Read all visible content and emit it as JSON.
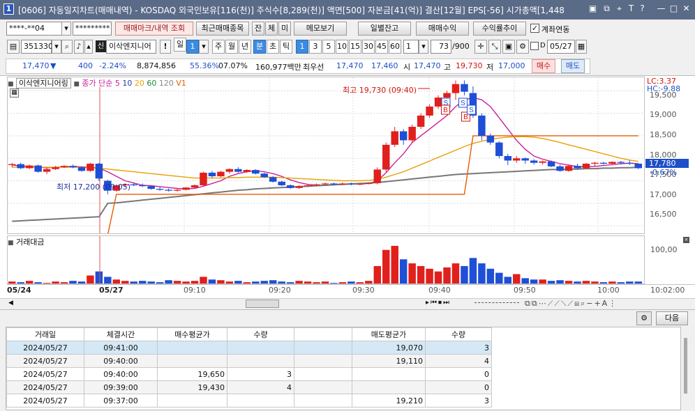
{
  "window": {
    "number": "1",
    "title": "[0606] 자동일지차트(매매내역) - KOSDAQ 외국인보유[116(천)] 주식수[8,289(천)] 액면[500] 자본금[41(억)] 결산[12월] EPS[-56] 시가총액[1,448"
  },
  "toolbar1": {
    "account": "****-**04",
    "password": "*********",
    "tabs": [
      "매매마크/내역 조회",
      "최근매매종목",
      "잔",
      "체",
      "미",
      "메모보기"
    ],
    "buttons": [
      "일별잔고",
      "매매수익",
      "수익률추이"
    ],
    "link_label": "계좌연동",
    "link_checked": true
  },
  "toolbar2": {
    "code": "351330",
    "badge": "신",
    "name": "이삭엔지니어",
    "period": [
      "일",
      "1",
      "주",
      "월",
      "년",
      "분",
      "초",
      "틱"
    ],
    "intervals": [
      "1",
      "3",
      "5",
      "10",
      "15",
      "30",
      "45",
      "60"
    ],
    "interval_select": "1",
    "count": "73",
    "count_total": "/900",
    "date": "05/27"
  },
  "quote": {
    "price": "17,470",
    "dir": "▼",
    "change": "400",
    "change_pct": "-2.24%",
    "volume": "8,874,856",
    "ratio": "55.36%",
    "ratio2": "07.07%",
    "amount": "160,977백만",
    "best_label": "최우선",
    "best_ask": "17,470",
    "best_bid": "17,460",
    "open_label": "시",
    "open": "17,470",
    "high_label": "고",
    "high": "19,730",
    "low_label": "저",
    "low": "17,000",
    "buy_label": "매수",
    "sell_label": "매도"
  },
  "chart": {
    "legend": {
      "name": "이삭엔지니어링",
      "ma_label": "종가 단순",
      "ma": [
        "5",
        "10",
        "20",
        "60",
        "120"
      ],
      "v": "V1"
    },
    "lc": "LC:3.37",
    "hc": "HC:-9.88",
    "annotations": {
      "max": "최고 19,730 (09:40)",
      "min": "최저 17,200 (09:05)"
    },
    "last": "17,780",
    "last_pct": "-0.67%",
    "y_labels": [
      "19,500",
      "19,000",
      "18,500",
      "18,000",
      "17,500",
      "17,000",
      "16,500"
    ],
    "markers": [
      "S",
      "B",
      "B",
      "S",
      "S"
    ],
    "vol_title": "거래대금",
    "vol_y": "100,00",
    "x_labels": [
      "05/24",
      "05/27",
      "09:10",
      "09:20",
      "09:30",
      "09:40",
      "09:50",
      "10:00",
      "10:02:00"
    ]
  },
  "chart_data": {
    "type": "candlestick",
    "y_range": [
      16300,
      19800
    ],
    "candles": [
      [
        17850,
        17900,
        17800,
        17870
      ],
      [
        17870,
        17900,
        17760,
        17780
      ],
      [
        17780,
        17860,
        17760,
        17840
      ],
      [
        17840,
        17860,
        17680,
        17700
      ],
      [
        17700,
        17780,
        17650,
        17760
      ],
      [
        17760,
        17830,
        17740,
        17800
      ],
      [
        17800,
        17850,
        17780,
        17830
      ],
      [
        17830,
        17860,
        17780,
        17800
      ],
      [
        17800,
        17820,
        17700,
        17720
      ],
      [
        17720,
        17900,
        17700,
        17880
      ],
      [
        17880,
        17900,
        17500,
        17550
      ],
      [
        17500,
        17520,
        17200,
        17280
      ],
      [
        17280,
        17420,
        17260,
        17400
      ],
      [
        17400,
        17440,
        17360,
        17420
      ],
      [
        17420,
        17460,
        17380,
        17400
      ],
      [
        17400,
        17440,
        17360,
        17380
      ],
      [
        17380,
        17400,
        17300,
        17320
      ],
      [
        17320,
        17360,
        17280,
        17300
      ],
      [
        17300,
        17330,
        17260,
        17280
      ],
      [
        17280,
        17320,
        17260,
        17300
      ],
      [
        17300,
        17360,
        17290,
        17350
      ],
      [
        17350,
        17420,
        17330,
        17400
      ],
      [
        17400,
        17700,
        17380,
        17680
      ],
      [
        17680,
        17720,
        17560,
        17600
      ],
      [
        17600,
        17720,
        17580,
        17700
      ],
      [
        17700,
        17780,
        17660,
        17760
      ],
      [
        17760,
        17800,
        17680,
        17700
      ],
      [
        17700,
        17760,
        17680,
        17740
      ],
      [
        17740,
        17760,
        17640,
        17660
      ],
      [
        17660,
        17680,
        17560,
        17580
      ],
      [
        17580,
        17600,
        17460,
        17480
      ],
      [
        17480,
        17500,
        17380,
        17400
      ],
      [
        17400,
        17420,
        17320,
        17340
      ],
      [
        17340,
        17400,
        17320,
        17380
      ],
      [
        17380,
        17420,
        17360,
        17400
      ],
      [
        17400,
        17440,
        17380,
        17420
      ],
      [
        17420,
        17460,
        17400,
        17440
      ],
      [
        17440,
        17460,
        17400,
        17420
      ],
      [
        17420,
        17460,
        17410,
        17440
      ],
      [
        17440,
        17460,
        17400,
        17420
      ],
      [
        17420,
        17440,
        17400,
        17430
      ],
      [
        17430,
        17460,
        17420,
        17450
      ],
      [
        17450,
        17800,
        17420,
        17750
      ],
      [
        17750,
        18350,
        17700,
        18300
      ],
      [
        18300,
        18700,
        18250,
        18600
      ],
      [
        18600,
        18650,
        18300,
        18400
      ],
      [
        18400,
        18750,
        18350,
        18700
      ],
      [
        18700,
        19000,
        18650,
        18950
      ],
      [
        18950,
        19200,
        18900,
        19150
      ],
      [
        19150,
        19400,
        19100,
        19350
      ],
      [
        19350,
        19500,
        19300,
        19450
      ],
      [
        19450,
        19730,
        19300,
        19650
      ],
      [
        19650,
        19730,
        19400,
        19480
      ],
      [
        19450,
        19600,
        18900,
        18950
      ],
      [
        18950,
        19000,
        18400,
        18500
      ],
      [
        18500,
        18550,
        18300,
        18350
      ],
      [
        18350,
        18380,
        18000,
        18050
      ],
      [
        18050,
        18100,
        17850,
        17950
      ],
      [
        17950,
        18050,
        17900,
        18000
      ],
      [
        18000,
        18020,
        17880,
        17950
      ],
      [
        17950,
        17980,
        17860,
        17900
      ],
      [
        17900,
        17950,
        17860,
        17930
      ],
      [
        17930,
        17950,
        17800,
        17820
      ],
      [
        17820,
        17860,
        17700,
        17720
      ],
      [
        17720,
        17860,
        17700,
        17830
      ],
      [
        17830,
        17880,
        17750,
        17780
      ],
      [
        17780,
        17900,
        17760,
        17880
      ],
      [
        17880,
        17920,
        17820,
        17900
      ],
      [
        17900,
        17920,
        17860,
        17880
      ],
      [
        17880,
        17930,
        17860,
        17920
      ],
      [
        17920,
        17940,
        17860,
        17900
      ],
      [
        17900,
        17950,
        17850,
        17880
      ],
      [
        17880,
        17890,
        17760,
        17780
      ]
    ],
    "volume": [
      5,
      4,
      6,
      4,
      3,
      5,
      4,
      6,
      5,
      14,
      20,
      12,
      8,
      6,
      5,
      6,
      5,
      4,
      7,
      6,
      5,
      6,
      12,
      8,
      7,
      5,
      6,
      4,
      5,
      6,
      7,
      5,
      4,
      6,
      5,
      4,
      5,
      3,
      4,
      5,
      4,
      6,
      28,
      52,
      58,
      38,
      32,
      28,
      24,
      20,
      26,
      32,
      28,
      40,
      32,
      24,
      18,
      12,
      16,
      10,
      8,
      8,
      6,
      7,
      6,
      5,
      6,
      5,
      4,
      5,
      4,
      5,
      5
    ],
    "ma": {
      "5": [
        17850,
        17830,
        17820,
        17800,
        17790,
        17800,
        17810,
        17820,
        17810,
        17800,
        17780,
        17700,
        17600,
        17500,
        17450,
        17400,
        17390,
        17370,
        17350,
        17330,
        17320,
        17330,
        17380,
        17440,
        17500,
        17600,
        17660,
        17700,
        17720,
        17700,
        17660,
        17600,
        17520,
        17460,
        17420,
        17400,
        17400,
        17410,
        17420,
        17430,
        17430,
        17440,
        17500,
        17680,
        17900,
        18100,
        18350,
        18500,
        18650,
        18800,
        18950,
        19150,
        19300,
        19350,
        19300,
        19150,
        18900,
        18650,
        18400,
        18200,
        18050,
        17980,
        17930,
        17880,
        17850,
        17820,
        17810,
        17820,
        17840,
        17860,
        17880,
        17890,
        17880
      ],
      "20": [
        17800,
        17800,
        17800,
        17800,
        17800,
        17800,
        17800,
        17800,
        17800,
        17790,
        17780,
        17760,
        17740,
        17720,
        17700,
        17680,
        17660,
        17640,
        17620,
        17600,
        17580,
        17560,
        17560,
        17560,
        17560,
        17570,
        17570,
        17580,
        17580,
        17580,
        17580,
        17570,
        17560,
        17550,
        17540,
        17530,
        17520,
        17510,
        17500,
        17500,
        17500,
        17510,
        17530,
        17580,
        17640,
        17700,
        17780,
        17860,
        17940,
        18020,
        18100,
        18180,
        18260,
        18330,
        18380,
        18420,
        18450,
        18470,
        18480,
        18480,
        18470,
        18440,
        18400,
        18350,
        18300,
        18250,
        18200,
        18150,
        18100,
        18050,
        18000,
        17960,
        17930
      ],
      "120": [
        16600,
        16610,
        16620,
        16630,
        16640,
        16650,
        16660,
        16670,
        16680,
        16690,
        16700,
        17000,
        17010,
        17030,
        17050,
        17070,
        17090,
        17110,
        17130,
        17150,
        17170,
        17190,
        17210,
        17230,
        17250,
        17270,
        17290,
        17300,
        17320,
        17330,
        17340,
        17350,
        17360,
        17370,
        17380,
        17390,
        17400,
        17410,
        17420,
        17430,
        17440,
        17450,
        17460,
        17480,
        17500,
        17520,
        17540,
        17560,
        17580,
        17600,
        17620,
        17640,
        17650,
        17660,
        17670,
        17680,
        17690,
        17700,
        17710,
        17720,
        17730,
        17740,
        17750,
        17750,
        17760,
        17760,
        17770,
        17770,
        17780,
        17780,
        17790,
        17790,
        17800
      ],
      "v": [
        16300,
        16300,
        16300,
        16300,
        16300,
        16300,
        16300,
        16300,
        16300,
        16300,
        16300,
        16300,
        17200,
        17200,
        17200,
        17200,
        17200,
        17200,
        17200,
        17200,
        17200,
        17200,
        17200,
        17200,
        17200,
        17200,
        17200,
        17200,
        17200,
        17200,
        17200,
        17200,
        17200,
        17200,
        17200,
        17200,
        17200,
        17200,
        17200,
        17200,
        17200,
        17200,
        17200,
        17200,
        17200,
        17200,
        17200,
        17200,
        17200,
        17200,
        17200,
        17200,
        17200,
        18500,
        18500,
        18500,
        18500,
        18500,
        18500,
        18500,
        18500,
        18500,
        18500,
        18500,
        18500,
        18500,
        18500,
        18500,
        18500,
        18500,
        18500,
        18500,
        18500
      ]
    }
  },
  "trades": {
    "headers": [
      "거래일",
      "체결시간",
      "매수평균가",
      "수량",
      "",
      "매도평균가",
      "수량"
    ],
    "rows": [
      [
        "2024/05/27",
        "09:41:00",
        "",
        "",
        "",
        "19,070",
        "3"
      ],
      [
        "2024/05/27",
        "09:40:00",
        "",
        "",
        "",
        "19,110",
        "4"
      ],
      [
        "2024/05/27",
        "09:40:00",
        "19,650",
        "3",
        "",
        "",
        "0"
      ],
      [
        "2024/05/27",
        "09:39:00",
        "19,430",
        "4",
        "",
        "",
        "0"
      ],
      [
        "2024/05/27",
        "09:37:00",
        "",
        "",
        "",
        "19,210",
        "3"
      ]
    ],
    "next": "다음"
  }
}
